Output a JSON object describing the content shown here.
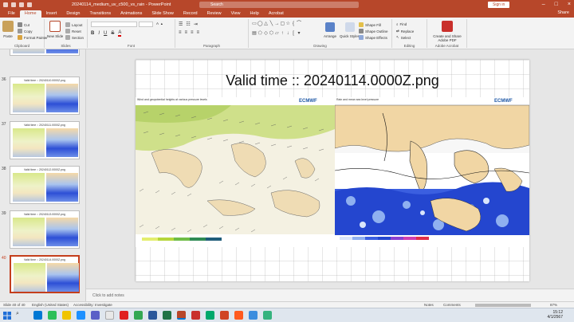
{
  "window": {
    "title": "20240114_medium_uv_c500_vs_rain  -  PowerPoint",
    "search_placeholder": "Search",
    "signin_label": "Sign in"
  },
  "tabs": [
    "File",
    "Home",
    "Insert",
    "Design",
    "Transitions",
    "Animations",
    "Slide Show",
    "Record",
    "Review",
    "View",
    "Help",
    "Acrobat"
  ],
  "share_label": "Share",
  "ribbon": {
    "clipboard": {
      "paste": "Paste",
      "cut": "Cut",
      "copy": "Copy",
      "format_painter": "Format Painter",
      "label": "Clipboard"
    },
    "slides": {
      "new_slide": "New Slide",
      "layout": "Layout",
      "reset": "Reset",
      "section": "Section",
      "label": "Slides"
    },
    "font": {
      "label": "Font"
    },
    "paragraph": {
      "label": "Paragraph"
    },
    "drawing": {
      "arrange": "Arrange",
      "quick_styles": "Quick Styles",
      "shape_fill": "Shape Fill",
      "shape_outline": "Shape Outline",
      "shape_effects": "Shape Effects",
      "label": "Drawing"
    },
    "editing": {
      "find": "Find",
      "replace": "Replace",
      "select": "Select",
      "label": "Editing"
    },
    "acrobat": {
      "create_share": "Create and Share Adobe PDF",
      "label": "Adobe Acrobat"
    }
  },
  "thumbnails": [
    {
      "num": "36",
      "title": "Valid time :: 20240110.0000Z.png"
    },
    {
      "num": "37",
      "title": "Valid time :: 20240111.0000Z.png"
    },
    {
      "num": "38",
      "title": "Valid time :: 20240112.0000Z.png"
    },
    {
      "num": "39",
      "title": "Valid time :: 20240113.0000Z.png"
    },
    {
      "num": "40",
      "title": "Valid time :: 20240114.0000Z.png"
    }
  ],
  "slide": {
    "title": "Valid time :: 20240114.0000Z.png",
    "map_left": {
      "caption": "Wind and geopotential heights at various pressure levels",
      "logo": "ECMWF"
    },
    "map_right": {
      "caption": "Rain and mean sea level pressure",
      "logo": "ECMWF"
    }
  },
  "notes_placeholder": "Click to add notes",
  "status": {
    "slide_count": "Slide 40 of 40",
    "language": "English (United States)",
    "accessibility": "Accessibility: Investigate",
    "notes": "Notes",
    "comments": "Comments",
    "zoom": "87%"
  },
  "taskbar": {
    "time": "15:12",
    "date": "4/1/2567"
  }
}
